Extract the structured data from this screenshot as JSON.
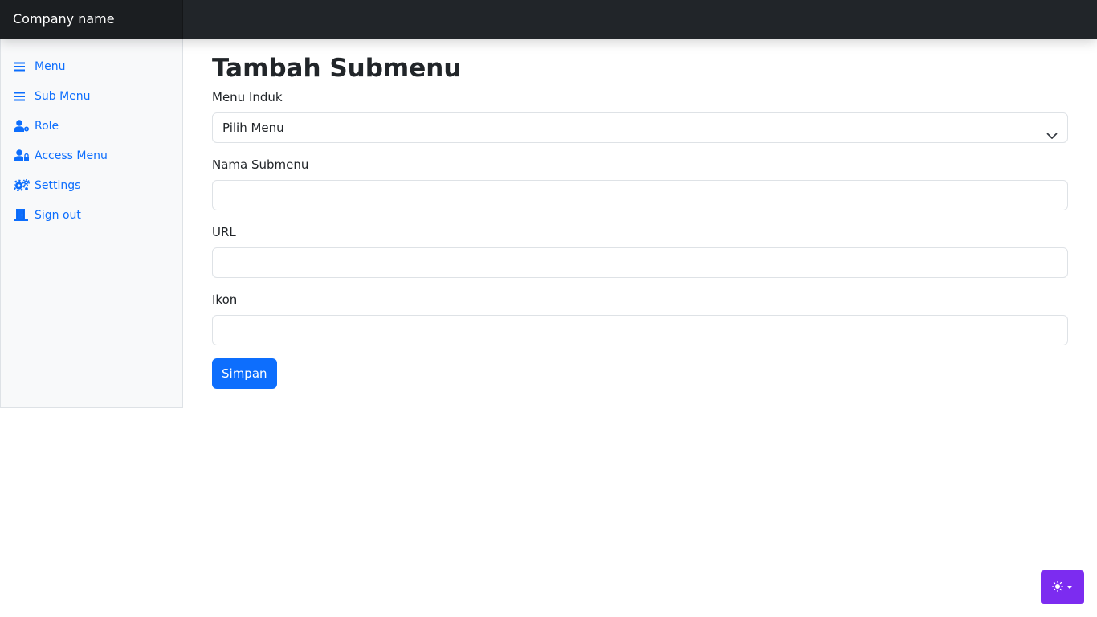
{
  "navbar": {
    "brand": "Company name"
  },
  "sidebar": {
    "items": [
      {
        "label": "Menu",
        "icon": "list-icon"
      },
      {
        "label": "Sub Menu",
        "icon": "list-icon"
      },
      {
        "label": "Role",
        "icon": "user-gear-icon"
      },
      {
        "label": "Access Menu",
        "icon": "user-lock-icon"
      },
      {
        "label": "Settings",
        "icon": "gears-icon"
      },
      {
        "label": "Sign out",
        "icon": "door-open-icon"
      }
    ]
  },
  "main": {
    "title": "Tambah Submenu",
    "form": {
      "parent_menu": {
        "label": "Menu Induk",
        "selected": "Pilih Menu"
      },
      "submenu_name": {
        "label": "Nama Submenu",
        "value": ""
      },
      "url": {
        "label": "URL",
        "value": ""
      },
      "icon": {
        "label": "Ikon",
        "value": ""
      },
      "submit_label": "Simpan"
    }
  },
  "theme_toggle": {
    "icon": "sun-icon"
  },
  "colors": {
    "primary": "#0d6efd",
    "navbar": "#212529",
    "sidebar_bg": "#f8f9fa",
    "theme_toggle": "#7c2cf0"
  }
}
